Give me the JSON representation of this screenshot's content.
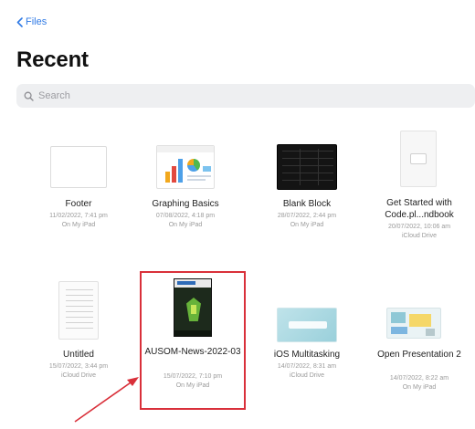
{
  "nav": {
    "back_label": "Files"
  },
  "header": {
    "title": "Recent"
  },
  "search": {
    "placeholder": "Search"
  },
  "files": [
    {
      "name": "Footer",
      "date": "11/02/2022, 7:41 pm",
      "location": "On My iPad"
    },
    {
      "name": "Graphing Basics",
      "date": "07/08/2022, 4:18 pm",
      "location": "On My iPad"
    },
    {
      "name": "Blank Block",
      "date": "28/07/2022, 2:44 pm",
      "location": "On My iPad"
    },
    {
      "name": "Get Started with Code.pl...ndbook",
      "date": "20/07/2022, 10:06 am",
      "location": "iCloud Drive"
    },
    {
      "name": "Untitled",
      "date": "15/07/2022, 3:44 pm",
      "location": "iCloud Drive"
    },
    {
      "name": "AUSOM-News-2022-03",
      "date": "15/07/2022, 7:10 pm",
      "location": "On My iPad"
    },
    {
      "name": "iOS Multitasking",
      "date": "14/07/2022, 8:31 am",
      "location": "iCloud Drive"
    },
    {
      "name": "Open Presentation 2",
      "date": "14/07/2022, 8:22 am",
      "location": "On My iPad"
    }
  ],
  "colors": {
    "accent": "#2f7ae5",
    "highlight": "#d9303a",
    "search_bg": "#eeeff1"
  },
  "icons": {
    "back": "chevron-left-icon",
    "search": "magnifier-icon"
  }
}
